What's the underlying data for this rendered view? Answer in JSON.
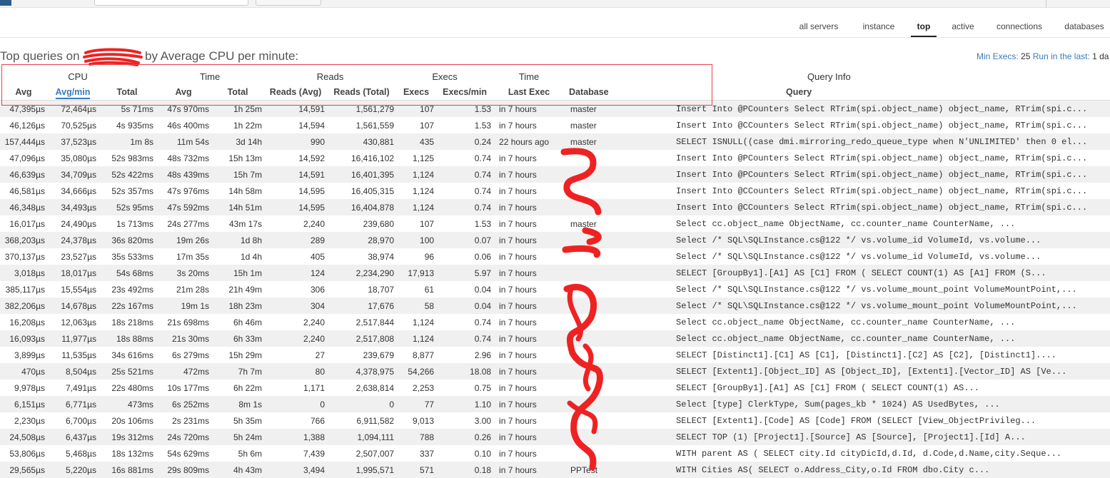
{
  "nav": {
    "tabs": [
      {
        "label": "all servers",
        "active": false
      },
      {
        "label": "instance",
        "active": false
      },
      {
        "label": "top",
        "active": true
      },
      {
        "label": "active",
        "active": false
      },
      {
        "label": "connections",
        "active": false
      },
      {
        "label": "databases",
        "active": false
      }
    ]
  },
  "heading": {
    "prefix": "Top queries on",
    "suffix": "by Average CPU per minute:"
  },
  "filters": {
    "min_execs_label": "Min Execs:",
    "min_execs_value": "25",
    "run_in_last_label": "Run in the last:",
    "run_in_last_value": "1 da"
  },
  "table": {
    "groups": {
      "cpu": "CPU",
      "time": "Time",
      "reads": "Reads",
      "execs": "Execs",
      "time2": "Time",
      "query_info": "Query Info"
    },
    "columns": {
      "avg": "Avg",
      "avg_min": "Avg/min",
      "total": "Total",
      "time_avg": "Avg",
      "time_total": "Total",
      "reads_avg": "Reads (Avg)",
      "reads_total": "Reads (Total)",
      "execs": "Execs",
      "execs_min": "Execs/min",
      "last_exec": "Last Exec",
      "database": "Database",
      "query": "Query"
    },
    "rows": [
      [
        "47,395µs",
        "72,464µs",
        "5s 71ms",
        "47s 970ms",
        "1h 25m",
        "14,591",
        "1,561,279",
        "107",
        "1.53",
        "in 7 hours",
        "master",
        "Insert Into @PCounters Select RTrim(spi.object_name) object_name, RTrim(spi.c..."
      ],
      [
        "46,126µs",
        "70,525µs",
        "4s 935ms",
        "46s 400ms",
        "1h 22m",
        "14,594",
        "1,561,559",
        "107",
        "1.53",
        "in 7 hours",
        "master",
        "Insert Into @CCounters Select RTrim(spi.object_name) object_name, RTrim(spi.c..."
      ],
      [
        "157,444µs",
        "37,523µs",
        "1m 8s",
        "11m 54s",
        "3d 14h",
        "990",
        "430,881",
        "435",
        "0.24",
        "22 hours ago",
        "master",
        "SELECT ISNULL((case dmi.mirroring_redo_queue_type when N'UNLIMITED' then 0 el..."
      ],
      [
        "47,096µs",
        "35,080µs",
        "52s 983ms",
        "48s 732ms",
        "15h 13m",
        "14,592",
        "16,416,102",
        "1,125",
        "0.74",
        "in 7 hours",
        "",
        "Insert Into @PCounters Select RTrim(spi.object_name) object_name, RTrim(spi.c..."
      ],
      [
        "46,639µs",
        "34,709µs",
        "52s 422ms",
        "48s 439ms",
        "15h 7m",
        "14,591",
        "16,401,395",
        "1,124",
        "0.74",
        "in 7 hours",
        "",
        "Insert Into @PCounters Select RTrim(spi.object_name) object_name, RTrim(spi.c..."
      ],
      [
        "46,581µs",
        "34,666µs",
        "52s 357ms",
        "47s 976ms",
        "14h 58m",
        "14,595",
        "16,405,315",
        "1,124",
        "0.74",
        "in 7 hours",
        "",
        "Insert Into @CCounters Select RTrim(spi.object_name) object_name, RTrim(spi.c..."
      ],
      [
        "46,348µs",
        "34,493µs",
        "52s 95ms",
        "47s 592ms",
        "14h 51m",
        "14,595",
        "16,404,878",
        "1,124",
        "0.74",
        "in 7 hours",
        "",
        "Insert Into @CCounters Select RTrim(spi.object_name) object_name, RTrim(spi.c..."
      ],
      [
        "16,017µs",
        "24,490µs",
        "1s 713ms",
        "24s 277ms",
        "43m 17s",
        "2,240",
        "239,680",
        "107",
        "1.53",
        "in 7 hours",
        "master",
        "Select cc.object_name ObjectName, cc.counter_name CounterName, ..."
      ],
      [
        "368,203µs",
        "24,378µs",
        "36s 820ms",
        "19m 26s",
        "1d 8h",
        "289",
        "28,970",
        "100",
        "0.07",
        "in 7 hours",
        "",
        "Select /* SQL\\SQLInstance.cs@122 */ vs.volume_id VolumeId, vs.volume..."
      ],
      [
        "370,137µs",
        "23,527µs",
        "35s 533ms",
        "17m 35s",
        "1d 4h",
        "405",
        "38,974",
        "96",
        "0.06",
        "in 7 hours",
        "",
        "Select /* SQL\\SQLInstance.cs@122 */ vs.volume_id VolumeId, vs.volume..."
      ],
      [
        "3,018µs",
        "18,017µs",
        "54s 68ms",
        "3s 20ms",
        "15h 1m",
        "124",
        "2,234,290",
        "17,913",
        "5.97",
        "in 7 hours",
        "",
        "SELECT [GroupBy1].[A1] AS [C1] FROM ( SELECT COUNT(1) AS [A1] FROM (S..."
      ],
      [
        "385,117µs",
        "15,554µs",
        "23s 492ms",
        "21m 28s",
        "21h 49m",
        "306",
        "18,707",
        "61",
        "0.04",
        "in 7 hours",
        "",
        "Select /* SQL\\SQLInstance.cs@122 */ vs.volume_mount_point VolumeMountPoint,..."
      ],
      [
        "382,206µs",
        "14,678µs",
        "22s 167ms",
        "19m 1s",
        "18h 23m",
        "304",
        "17,676",
        "58",
        "0.04",
        "in 7 hours",
        "",
        "Select /* SQL\\SQLInstance.cs@122 */ vs.volume_mount_point VolumeMountPoint,..."
      ],
      [
        "16,208µs",
        "12,063µs",
        "18s 218ms",
        "21s 698ms",
        "6h 46m",
        "2,240",
        "2,517,844",
        "1,124",
        "0.74",
        "in 7 hours",
        "",
        "Select cc.object_name ObjectName, cc.counter_name CounterName, ..."
      ],
      [
        "16,093µs",
        "11,977µs",
        "18s 88ms",
        "21s 30ms",
        "6h 33m",
        "2,240",
        "2,517,808",
        "1,124",
        "0.74",
        "in 7 hours",
        "",
        "Select cc.object_name ObjectName, cc.counter_name CounterName, ..."
      ],
      [
        "3,899µs",
        "11,535µs",
        "34s 616ms",
        "6s 279ms",
        "15h 29m",
        "27",
        "239,679",
        "8,877",
        "2.96",
        "in 7 hours",
        "",
        "SELECT [Distinct1].[C1] AS [C1], [Distinct1].[C2] AS [C2], [Distinct1]...."
      ],
      [
        "470µs",
        "8,504µs",
        "25s 521ms",
        "472ms",
        "7h 7m",
        "80",
        "4,378,975",
        "54,266",
        "18.08",
        "in 7 hours",
        "",
        "SELECT [Extent1].[Object_ID] AS [Object_ID], [Extent1].[Vector_ID] AS [Ve..."
      ],
      [
        "9,978µs",
        "7,491µs",
        "22s 480ms",
        "10s 177ms",
        "6h 22m",
        "1,171",
        "2,638,814",
        "2,253",
        "0.75",
        "in 7 hours",
        "",
        "SELECT [GroupBy1].[A1] AS [C1] FROM ( SELECT COUNT(1) AS..."
      ],
      [
        "6,151µs",
        "6,771µs",
        "473ms",
        "6s 252ms",
        "8m 1s",
        "0",
        "0",
        "77",
        "1.10",
        "in 7 hours",
        "",
        "Select [type] ClerkType, Sum(pages_kb * 1024) AS UsedBytes, ..."
      ],
      [
        "2,230µs",
        "6,700µs",
        "20s 106ms",
        "2s 231ms",
        "5h 35m",
        "766",
        "6,911,582",
        "9,013",
        "3.00",
        "in 7 hours",
        "",
        "SELECT [Extent1].[Code] AS [Code] FROM (SELECT [View_ObjectPrivileg..."
      ],
      [
        "24,508µs",
        "6,437µs",
        "19s 312ms",
        "24s 720ms",
        "5h 24m",
        "1,388",
        "1,094,111",
        "788",
        "0.26",
        "in 7 hours",
        "",
        "SELECT TOP (1) [Project1].[Source] AS [Source], [Project1].[Id] A..."
      ],
      [
        "53,806µs",
        "5,468µs",
        "18s 132ms",
        "54s 629ms",
        "5h 6m",
        "7,439",
        "2,507,007",
        "337",
        "0.10",
        "in 7 hours",
        "",
        "WITH parent AS ( SELECT city.Id cityDicId,d.Id, d.Code,d.Name,city.Seque..."
      ],
      [
        "29,565µs",
        "5,220µs",
        "16s 881ms",
        "29s 809ms",
        "4h 43m",
        "3,494",
        "1,995,571",
        "571",
        "0.18",
        "in 7 hours",
        "PPTest",
        "WITH Cities AS( SELECT o.Address_City,o.Id FROM dbo.City c..."
      ]
    ]
  },
  "colors": {
    "accent": "#3a7abf",
    "stripe": "#f0f0f0",
    "annotation": "#e8424a"
  }
}
